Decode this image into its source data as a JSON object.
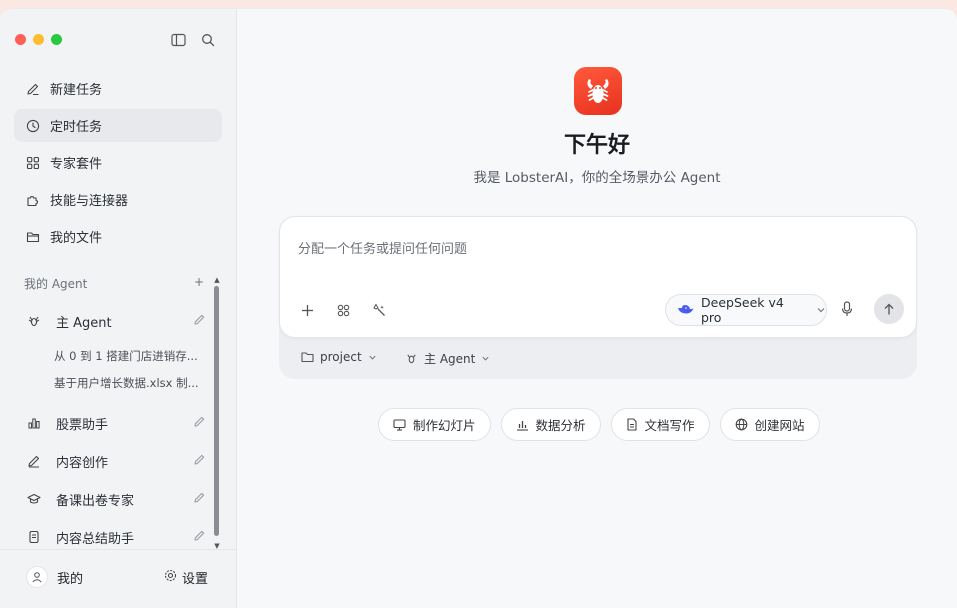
{
  "window": {
    "traffic_lights": [
      "#ff5f57",
      "#febc2e",
      "#28c840"
    ]
  },
  "sidebar": {
    "top_icons": [
      "sidebar-toggle-icon",
      "search-icon"
    ],
    "nav": [
      {
        "label": "新建任务",
        "icon": "pencil-icon"
      },
      {
        "label": "定时任务",
        "icon": "clock-icon",
        "active": true
      },
      {
        "label": "专家套件",
        "icon": "grid-icon"
      },
      {
        "label": "技能与连接器",
        "icon": "puzzle-icon"
      },
      {
        "label": "我的文件",
        "icon": "folder-icon"
      }
    ],
    "agent_section": {
      "title": "我的 Agent",
      "add": "+"
    },
    "agents": {
      "main": {
        "label": "主 Agent"
      },
      "sub": [
        "从 0 到 1 搭建门店进销存...",
        "基于用户增长数据.xlsx 制..."
      ],
      "others": [
        {
          "label": "股票助手"
        },
        {
          "label": "内容创作"
        },
        {
          "label": "备课出卷专家"
        },
        {
          "label": "内容总结助手"
        }
      ]
    },
    "footer": {
      "me": "我的",
      "settings": "设置"
    }
  },
  "main": {
    "greeting": "下午好",
    "subtitle": "我是 LobsterAI，你的全场景办公 Agent",
    "composer": {
      "placeholder": "分配一个任务或提问任何问题",
      "model": "DeepSeek v4 pro"
    },
    "context": {
      "project": "project",
      "agent": "主 Agent"
    },
    "chips": [
      "制作幻灯片",
      "数据分析",
      "文档写作",
      "创建网站"
    ]
  },
  "colors": {
    "logo": "#f0442a",
    "accent": "#4a5cf0"
  }
}
